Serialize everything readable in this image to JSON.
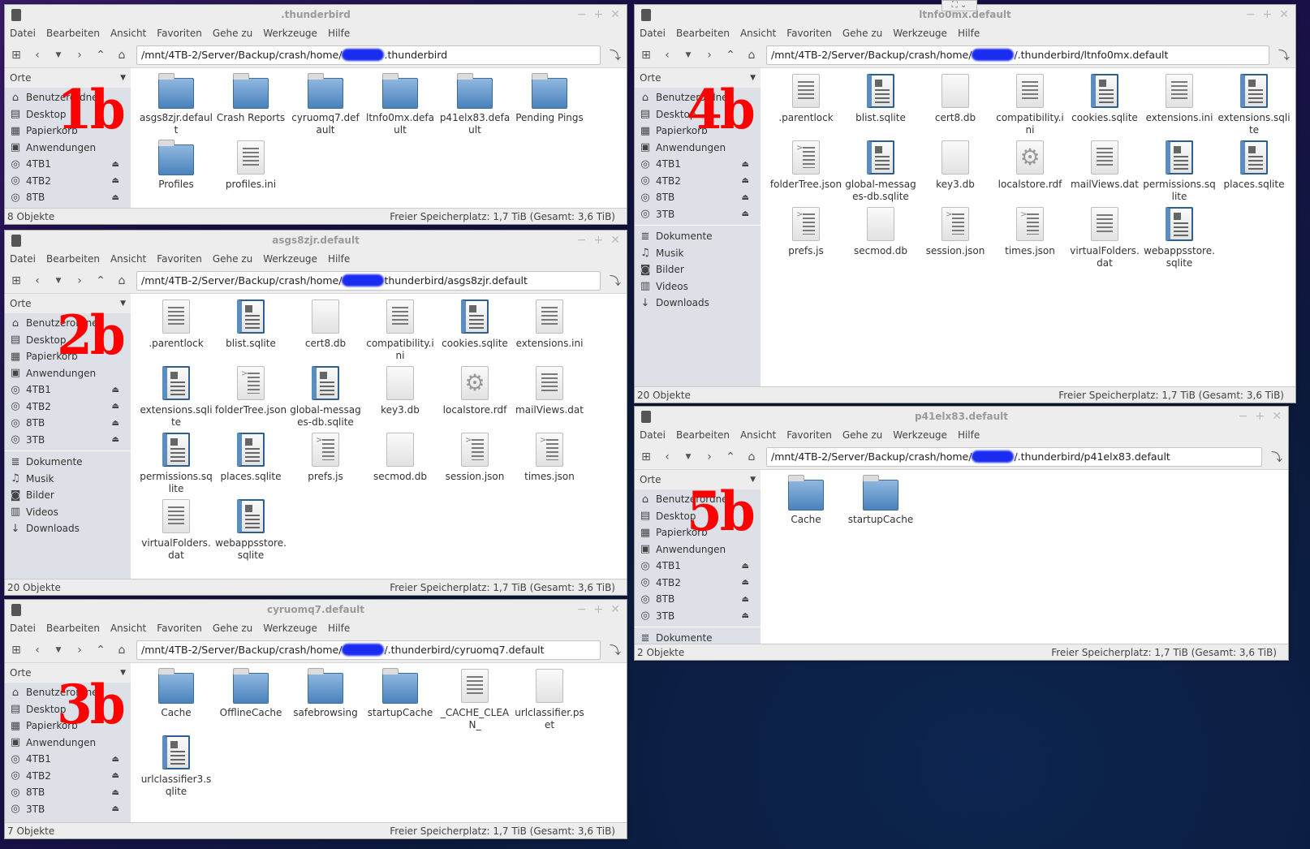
{
  "menu": [
    "Datei",
    "Bearbeiten",
    "Ansicht",
    "Favoriten",
    "Gehe zu",
    "Werkzeuge",
    "Hilfe"
  ],
  "orte_label": "Orte",
  "path_prefix": "/mnt/4TB-2/Server/Backup/crash/home/",
  "free_space": "Freier Speicherplatz: 1,7 TiB (Gesamt: 3,6 TiB)",
  "windows": [
    {
      "title": ".thunderbird",
      "label": "1b",
      "path_suffix": ".thunderbird",
      "status": "8 Objekte",
      "places": [
        "Benutzerordner",
        "Desktop",
        "Papierkorb",
        "Anwendungen",
        "4TB1",
        "4TB2",
        "8TB"
      ],
      "items": [
        {
          "name": "asgs8zjr.default",
          "type": "folder"
        },
        {
          "name": "Crash Reports",
          "type": "folder"
        },
        {
          "name": "cyruomq7.default",
          "type": "folder"
        },
        {
          "name": "ltnfo0mx.default",
          "type": "folder"
        },
        {
          "name": "p41elx83.default",
          "type": "folder"
        },
        {
          "name": "Pending Pings",
          "type": "folder"
        },
        {
          "name": "Profiles",
          "type": "folder"
        },
        {
          "name": "profiles.ini",
          "type": "text"
        }
      ]
    },
    {
      "title": "asgs8zjr.default",
      "label": "2b",
      "path_suffix": "thunderbird/asgs8zjr.default",
      "status": "20 Objekte",
      "places": [
        "Benutzerordner",
        "Desktop",
        "Papierkorb",
        "Anwendungen",
        "4TB1",
        "4TB2",
        "8TB",
        "3TB",
        "Dokumente",
        "Musik",
        "Bilder",
        "Videos",
        "Downloads"
      ],
      "items": [
        {
          "name": ".parentlock",
          "type": "text"
        },
        {
          "name": "blist.sqlite",
          "type": "doc"
        },
        {
          "name": "cert8.db",
          "type": "blank"
        },
        {
          "name": "compatibility.ini",
          "type": "text"
        },
        {
          "name": "cookies.sqlite",
          "type": "doc"
        },
        {
          "name": "extensions.ini",
          "type": "text"
        },
        {
          "name": "extensions.sqlite",
          "type": "doc"
        },
        {
          "name": "folderTree.json",
          "type": "script"
        },
        {
          "name": "global-messages-db.sqlite",
          "type": "doc"
        },
        {
          "name": "key3.db",
          "type": "blank"
        },
        {
          "name": "localstore.rdf",
          "type": "gear"
        },
        {
          "name": "mailViews.dat",
          "type": "text"
        },
        {
          "name": "permissions.sqlite",
          "type": "doc"
        },
        {
          "name": "places.sqlite",
          "type": "doc"
        },
        {
          "name": "prefs.js",
          "type": "script"
        },
        {
          "name": "secmod.db",
          "type": "blank"
        },
        {
          "name": "session.json",
          "type": "script"
        },
        {
          "name": "times.json",
          "type": "script"
        },
        {
          "name": "virtualFolders.dat",
          "type": "text"
        },
        {
          "name": "webappsstore.sqlite",
          "type": "doc"
        }
      ]
    },
    {
      "title": "cyruomq7.default",
      "label": "3b",
      "path_suffix": "/.thunderbird/cyruomq7.default",
      "status": "7 Objekte",
      "places": [
        "Benutzerordner",
        "Desktop",
        "Papierkorb",
        "Anwendungen",
        "4TB1",
        "4TB2",
        "8TB",
        "3TB"
      ],
      "items": [
        {
          "name": "Cache",
          "type": "folder"
        },
        {
          "name": "OfflineCache",
          "type": "folder"
        },
        {
          "name": "safebrowsing",
          "type": "folder"
        },
        {
          "name": "startupCache",
          "type": "folder"
        },
        {
          "name": "_CACHE_CLEAN_",
          "type": "text"
        },
        {
          "name": "urlclassifier.pset",
          "type": "blank"
        },
        {
          "name": "urlclassifier3.sqlite",
          "type": "doc"
        }
      ]
    },
    {
      "title": "ltnfo0mx.default",
      "label": "4b",
      "path_suffix": "/.thunderbird/ltnfo0mx.default",
      "status": "20 Objekte",
      "places": [
        "Benutzerordner",
        "Desktop",
        "Papierkorb",
        "Anwendungen",
        "4TB1",
        "4TB2",
        "8TB",
        "3TB",
        "Dokumente",
        "Musik",
        "Bilder",
        "Videos",
        "Downloads"
      ],
      "items": [
        {
          "name": ".parentlock",
          "type": "text"
        },
        {
          "name": "blist.sqlite",
          "type": "doc"
        },
        {
          "name": "cert8.db",
          "type": "blank"
        },
        {
          "name": "compatibility.ini",
          "type": "text"
        },
        {
          "name": "cookies.sqlite",
          "type": "doc"
        },
        {
          "name": "extensions.ini",
          "type": "text"
        },
        {
          "name": "extensions.sqlite",
          "type": "doc"
        },
        {
          "name": "folderTree.json",
          "type": "script"
        },
        {
          "name": "global-messages-db.sqlite",
          "type": "doc"
        },
        {
          "name": "key3.db",
          "type": "blank"
        },
        {
          "name": "localstore.rdf",
          "type": "gear"
        },
        {
          "name": "mailViews.dat",
          "type": "text"
        },
        {
          "name": "permissions.sqlite",
          "type": "doc"
        },
        {
          "name": "places.sqlite",
          "type": "doc"
        },
        {
          "name": "prefs.js",
          "type": "script"
        },
        {
          "name": "secmod.db",
          "type": "blank"
        },
        {
          "name": "session.json",
          "type": "script"
        },
        {
          "name": "times.json",
          "type": "script"
        },
        {
          "name": "virtualFolders.dat",
          "type": "text"
        },
        {
          "name": "webappsstore.sqlite",
          "type": "doc"
        }
      ]
    },
    {
      "title": "p41elx83.default",
      "label": "5b",
      "path_suffix": "/.thunderbird/p41elx83.default",
      "status": "2 Objekte",
      "places": [
        "Benutzerordner",
        "Desktop",
        "Papierkorb",
        "Anwendungen",
        "4TB1",
        "4TB2",
        "8TB",
        "3TB",
        "Dokumente"
      ],
      "items": [
        {
          "name": "Cache",
          "type": "folder"
        },
        {
          "name": "startupCache",
          "type": "folder"
        }
      ]
    }
  ]
}
